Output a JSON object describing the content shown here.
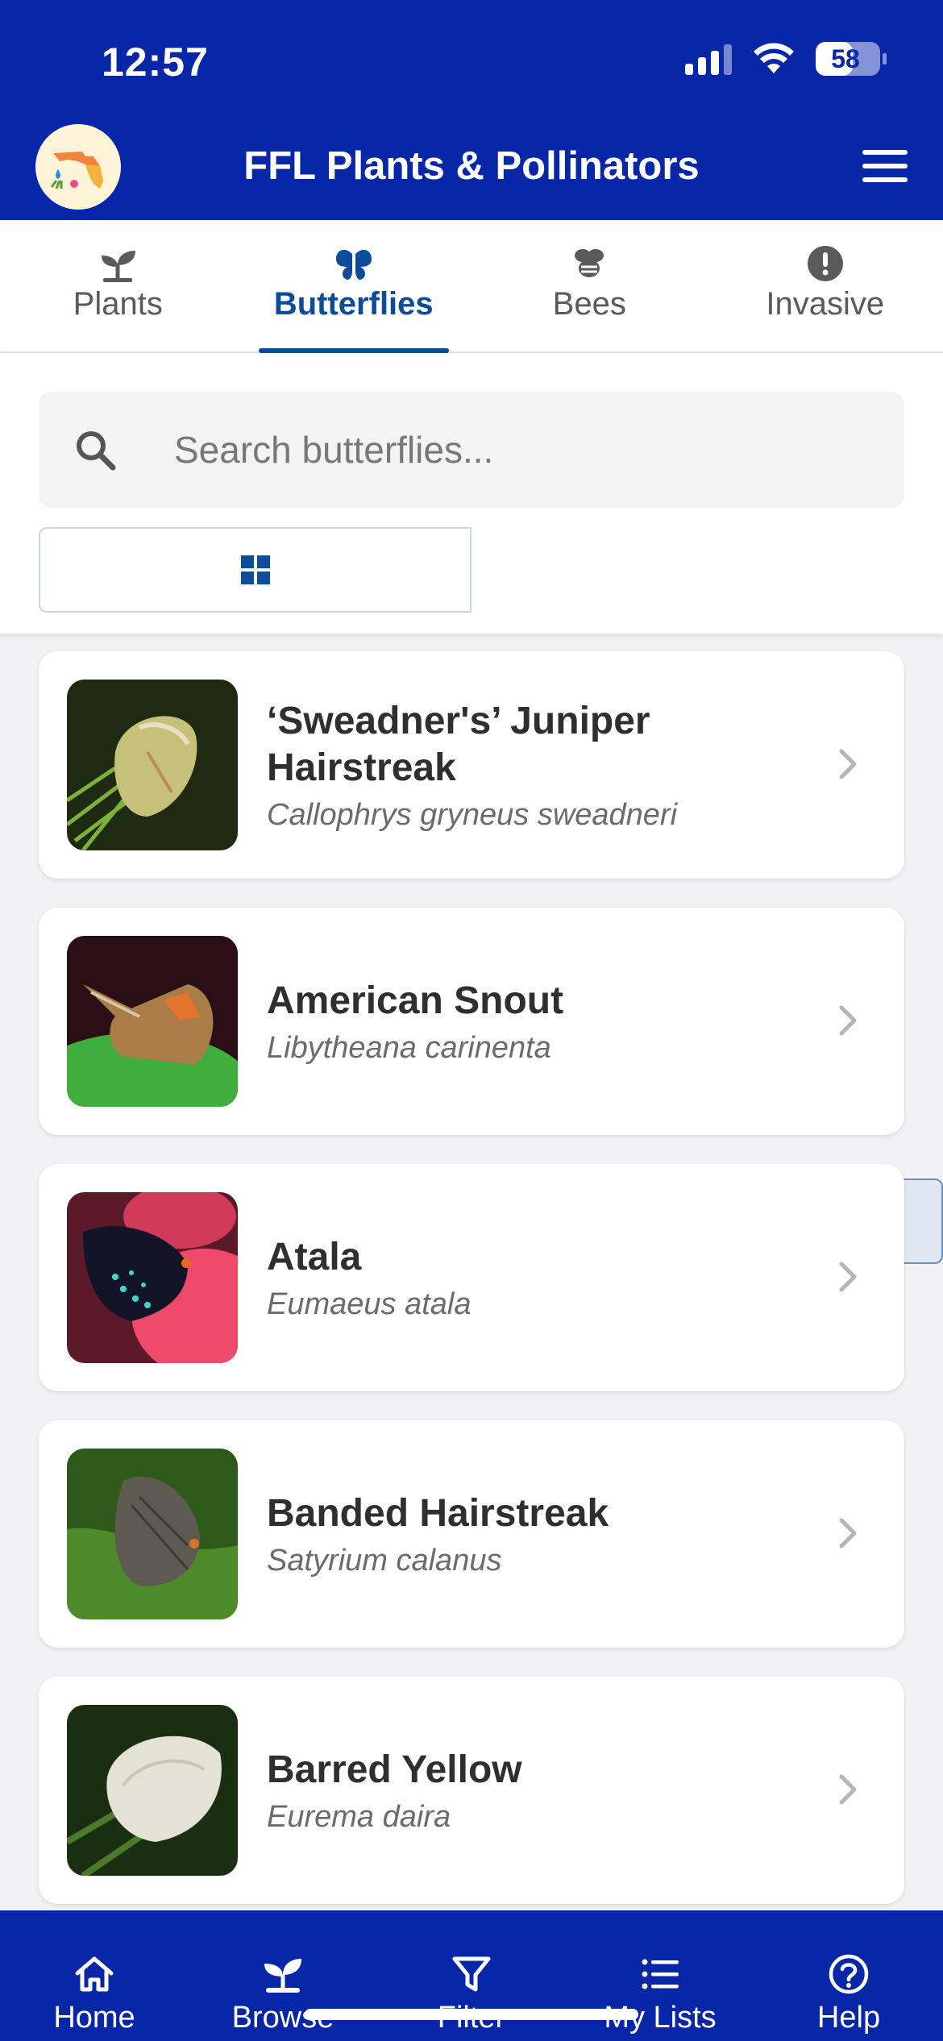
{
  "status_bar": {
    "time": "12:57",
    "battery": "58",
    "battery_fraction": 0.58
  },
  "app_bar": {
    "title": "FFL Plants & Pollinators",
    "logo_icon": "florida-logo-icon",
    "menu_icon": "hamburger-menu-icon"
  },
  "tabs": [
    {
      "label": "Plants",
      "icon": "seedling-icon",
      "active": false
    },
    {
      "label": "Butterflies",
      "icon": "butterfly-icon",
      "active": true
    },
    {
      "label": "Bees",
      "icon": "bee-icon",
      "active": false
    },
    {
      "label": "Invasive",
      "icon": "exclamation-circle-icon",
      "active": false
    }
  ],
  "search": {
    "placeholder": "Search butterflies..."
  },
  "view_toggle": {
    "selected": "list",
    "options": [
      "grid",
      "list"
    ]
  },
  "butterflies": [
    {
      "common": "‘Sweadner's’ Juniper Hairstreak",
      "scientific": "Callophrys gryneus sweadneri"
    },
    {
      "common": "American Snout",
      "scientific": "Libytheana carinenta"
    },
    {
      "common": "Atala",
      "scientific": "Eumaeus atala"
    },
    {
      "common": "Banded Hairstreak",
      "scientific": "Satyrium calanus"
    },
    {
      "common": "Barred Yellow",
      "scientific": "Eurema daira"
    }
  ],
  "bottom_nav": [
    {
      "label": "Home",
      "icon": "home-icon"
    },
    {
      "label": "Browse",
      "icon": "seedling-icon",
      "active": true
    },
    {
      "label": "Filter",
      "icon": "filter-icon"
    },
    {
      "label": "My Lists",
      "icon": "list-icon"
    },
    {
      "label": "Help",
      "icon": "help-circle-icon"
    }
  ],
  "colors": {
    "brand_blue": "#0826a8",
    "accent_blue": "#0c4c9a",
    "toggle_active_bg": "#dfe8f2"
  }
}
